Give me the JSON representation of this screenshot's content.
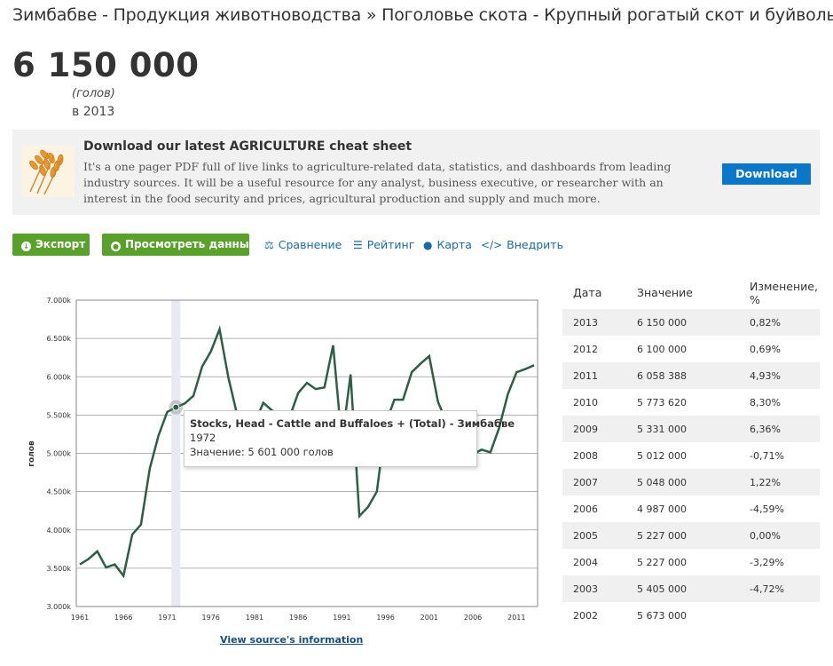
{
  "header": {
    "title": "Зимбабве - Продукция животноводства » Поголовье скота - Крупный рогатый скот и буйволы",
    "value": "6 150 000",
    "unit": "(голов)",
    "year_text": "в 2013"
  },
  "banner": {
    "image": "wheat-icon",
    "title": "Download our latest AGRICULTURE cheat sheet",
    "text": "It's a one pager PDF full of live links to agriculture-related data, statistics, and dashboards from leading industry sources. It will be a useful resource for any analyst, business executive, or researcher with an interest in the food security and prices, agricultural production and supply and much more.",
    "button": "Download"
  },
  "toolbar": {
    "export": "Экспорт",
    "view_data": "Просмотреть данные",
    "compare": "Сравнение",
    "rating": "Рейтинг",
    "map": "Карта",
    "embed": "Внедрить"
  },
  "colors": {
    "line": "#2d5e46",
    "green_button": "#5aa02c",
    "blue_button": "#0a77c8",
    "link": "#1a6aa6"
  },
  "chart_data": {
    "type": "line",
    "ylabel": "голов",
    "ylim": [
      3000000,
      7000000
    ],
    "ytick_labels": [
      "3.000k",
      "3.500k",
      "4.000k",
      "4.500k",
      "5.000k",
      "5.500k",
      "6.000k",
      "6.500k",
      "7.000k"
    ],
    "xtick_labels": [
      "1961",
      "1966",
      "1971",
      "1976",
      "1981",
      "1986",
      "1991",
      "1996",
      "2001",
      "2006",
      "2011"
    ],
    "grid": true,
    "highlight_year": 1972,
    "x": [
      1961,
      1962,
      1963,
      1964,
      1965,
      1966,
      1967,
      1968,
      1969,
      1970,
      1971,
      1972,
      1973,
      1974,
      1975,
      1976,
      1977,
      1978,
      1979,
      1980,
      1981,
      1982,
      1983,
      1984,
      1985,
      1986,
      1987,
      1988,
      1989,
      1990,
      1991,
      1992,
      1993,
      1994,
      1995,
      1996,
      1997,
      1998,
      1999,
      2000,
      2001,
      2002,
      2003,
      2004,
      2005,
      2006,
      2007,
      2008,
      2009,
      2010,
      2011,
      2012,
      2013
    ],
    "series": [
      {
        "values": [
          3550000,
          3620000,
          3720000,
          3510000,
          3550000,
          3400000,
          3940000,
          4070000,
          4800000,
          5230000,
          5540000,
          5601000,
          5650000,
          5750000,
          6130000,
          6330000,
          6620000,
          5990000,
          5510000,
          5500000,
          5390000,
          5660000,
          5560000,
          5500000,
          5470000,
          5790000,
          5920000,
          5840000,
          5860000,
          6410000,
          5150000,
          6030000,
          4180000,
          4300000,
          4500000,
          5380000,
          5700000,
          5700000,
          6060000,
          6170000,
          6270000,
          5673000,
          5405000,
          5227000,
          5227000,
          4987000,
          5048000,
          5012000,
          5331000,
          5773620,
          6058388,
          6100000,
          6150000
        ]
      }
    ],
    "tooltip": {
      "title": "Stocks, Head - Cattle and Buffaloes + (Total) - Зимбабве",
      "year": "1972",
      "value_text": "Значение: 5 601 000 голов"
    }
  },
  "source_link": "View source's information",
  "table": {
    "headers": {
      "date": "Дата",
      "value": "Значение",
      "change": "Изменение, %"
    },
    "rows": [
      {
        "date": "2013",
        "value": "6 150 000",
        "change": "0,82%"
      },
      {
        "date": "2012",
        "value": "6 100 000",
        "change": "0,69%"
      },
      {
        "date": "2011",
        "value": "6 058 388",
        "change": "4,93%"
      },
      {
        "date": "2010",
        "value": "5 773 620",
        "change": "8,30%"
      },
      {
        "date": "2009",
        "value": "5 331 000",
        "change": "6,36%"
      },
      {
        "date": "2008",
        "value": "5 012 000",
        "change": "-0,71%"
      },
      {
        "date": "2007",
        "value": "5 048 000",
        "change": "1,22%"
      },
      {
        "date": "2006",
        "value": "4 987 000",
        "change": "-4,59%"
      },
      {
        "date": "2005",
        "value": "5 227 000",
        "change": "0,00%"
      },
      {
        "date": "2004",
        "value": "5 227 000",
        "change": "-3,29%"
      },
      {
        "date": "2003",
        "value": "5 405 000",
        "change": "-4,72%"
      },
      {
        "date": "2002",
        "value": "5 673 000",
        "change": ""
      }
    ]
  }
}
